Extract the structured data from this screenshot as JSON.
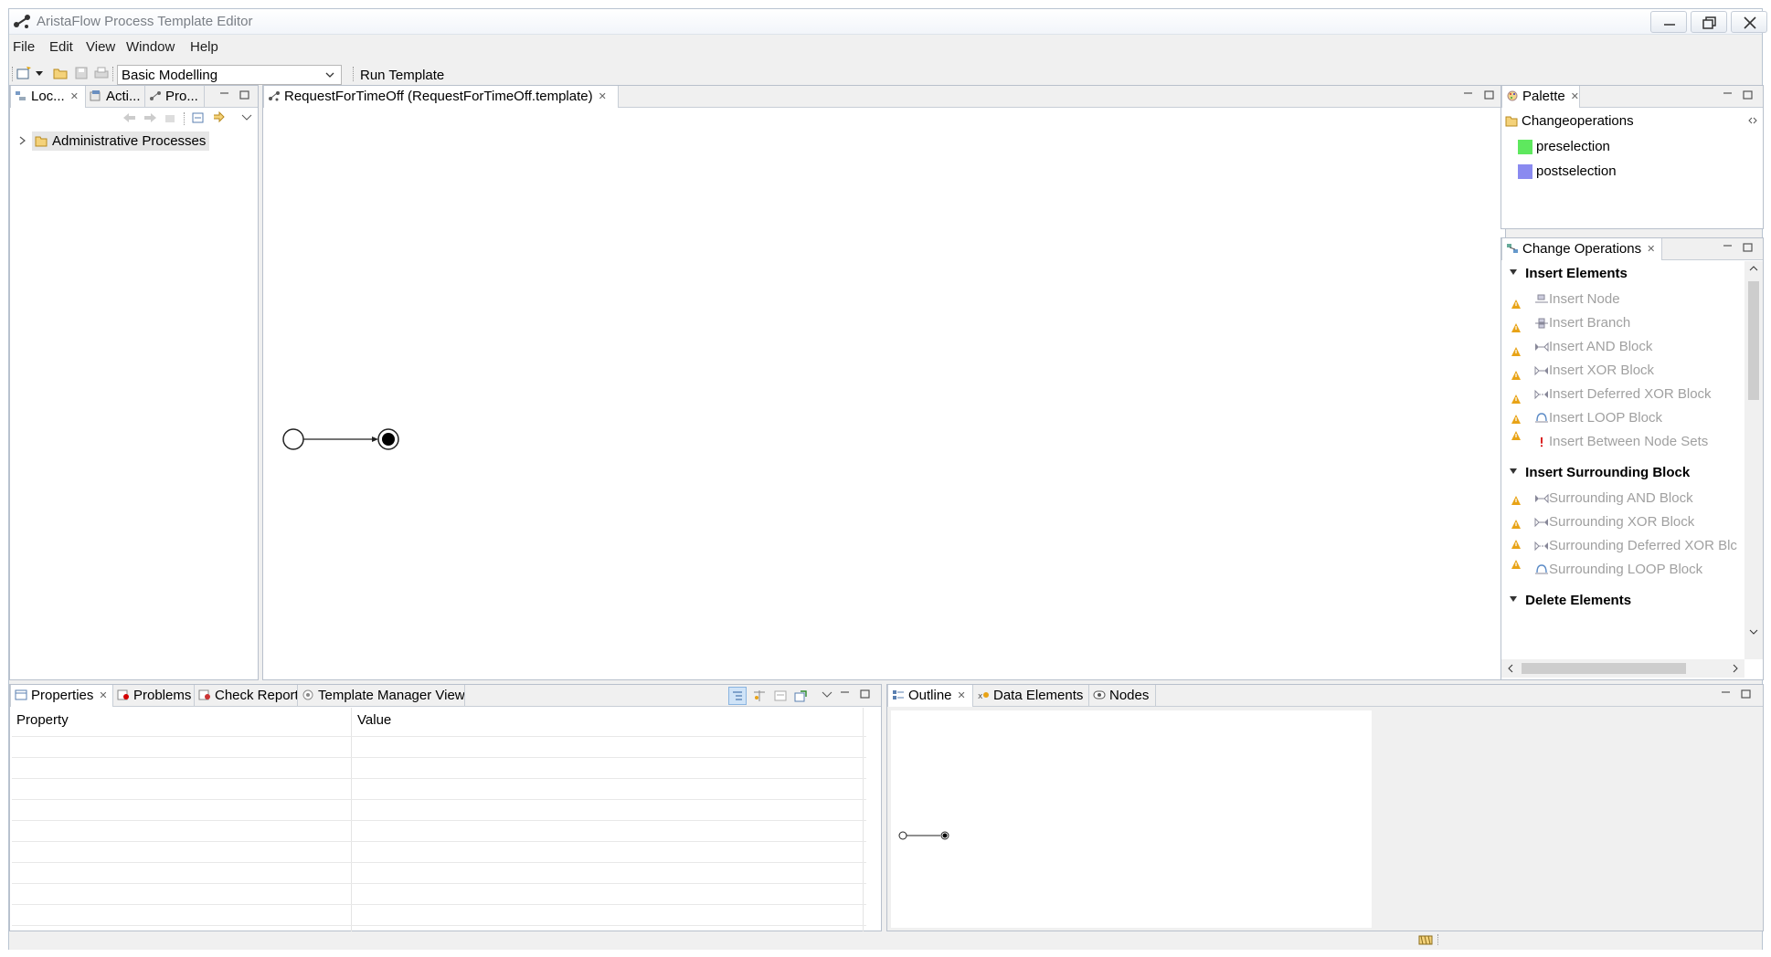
{
  "window": {
    "title": "AristaFlow Process Template Editor"
  },
  "menu": [
    "File",
    "Edit",
    "View",
    "Window",
    "Help"
  ],
  "toolbar": {
    "perspective_value": "Basic Modelling",
    "run_template_label": "Run Template"
  },
  "left_pane": {
    "tabs": [
      "Loc...",
      "Acti...",
      "Pro..."
    ],
    "tree_item": "Administrative Processes"
  },
  "editor": {
    "tab_label": "RequestForTimeOff (RequestForTimeOff.template)"
  },
  "palette": {
    "tab_label": "Palette",
    "group_label": "Changeoperations",
    "items": [
      {
        "label": "preselection",
        "color": "#5ee85e"
      },
      {
        "label": "postselection",
        "color": "#8a8af0"
      }
    ]
  },
  "change_ops": {
    "tab_label": "Change Operations",
    "sections": [
      {
        "title": "Insert Elements",
        "items": [
          "Insert Node",
          "Insert Branch",
          "Insert AND Block",
          "Insert XOR Block",
          "Insert Deferred XOR Block",
          "Insert LOOP Block",
          "Insert Between Node Sets"
        ]
      },
      {
        "title": "Insert Surrounding Block",
        "items": [
          "Surrounding AND Block",
          "Surrounding XOR Block",
          "Surrounding Deferred XOR Blc",
          "Surrounding LOOP Block"
        ]
      },
      {
        "title": "Delete Elements",
        "items": []
      }
    ]
  },
  "bottom_left": {
    "tabs": [
      "Properties",
      "Problems",
      "Check Report",
      "Template Manager View"
    ],
    "columns": [
      "Property",
      "Value"
    ]
  },
  "bottom_right": {
    "tabs": [
      "Outline",
      "Data Elements",
      "Nodes"
    ]
  },
  "colors": {
    "warning": "#e8a317",
    "error": "#d40000",
    "selection": "#e6e6e6"
  }
}
